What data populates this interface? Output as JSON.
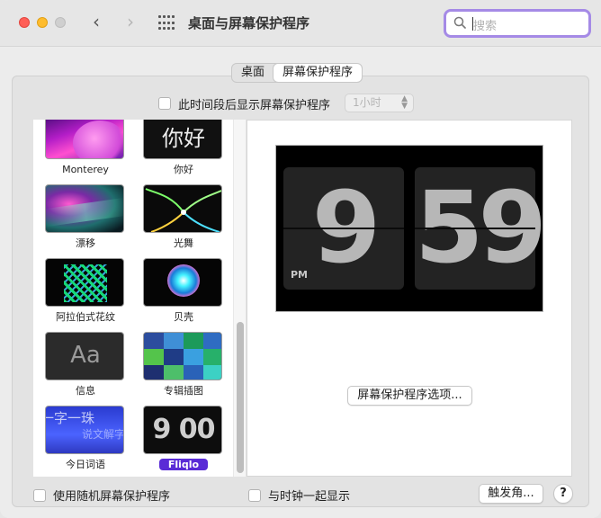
{
  "window": {
    "title": "桌面与屏幕保护程序",
    "search_placeholder": "搜索"
  },
  "tabs": [
    {
      "label": "桌面",
      "active": false
    },
    {
      "label": "屏幕保护程序",
      "active": true
    }
  ],
  "idle": {
    "label": "此时间段后显示屏幕保护程序",
    "checked": false,
    "popup_value": "1小时"
  },
  "screensavers": [
    {
      "name": "Monterey",
      "icon": "monterey-thumbnail"
    },
    {
      "name": "你好",
      "icon": "hello-thumbnail",
      "thumb_text": "你好"
    },
    {
      "name": "漂移",
      "icon": "drift-thumbnail"
    },
    {
      "name": "光舞",
      "icon": "flurry-thumbnail"
    },
    {
      "name": "阿拉伯式花纹",
      "icon": "arabesque-thumbnail"
    },
    {
      "name": "贝壳",
      "icon": "shell-thumbnail"
    },
    {
      "name": "信息",
      "icon": "message-thumbnail",
      "thumb_text": "Aa"
    },
    {
      "name": "专辑插图",
      "icon": "album-artwork-thumbnail"
    },
    {
      "name": "今日词语",
      "icon": "word-of-the-day-thumbnail",
      "thumb_text": "一字一珠",
      "thumb_text2": "说文解字"
    },
    {
      "name": "Fliqlo",
      "icon": "fliqlo-thumbnail",
      "thumb_text": "9 00",
      "selected": true
    }
  ],
  "preview": {
    "hour": "9",
    "minute": "59",
    "ampm": "PM"
  },
  "buttons": {
    "options": "屏幕保护程序选项...",
    "hot_corners": "触发角...",
    "help": "?"
  },
  "bottom": {
    "random_label": "使用随机屏幕保护程序",
    "random_checked": false,
    "clock_label": "与时钟一起显示",
    "clock_checked": false
  },
  "colors": {
    "accent": "#5a2bd6",
    "search_ring": "#a58ae6"
  }
}
